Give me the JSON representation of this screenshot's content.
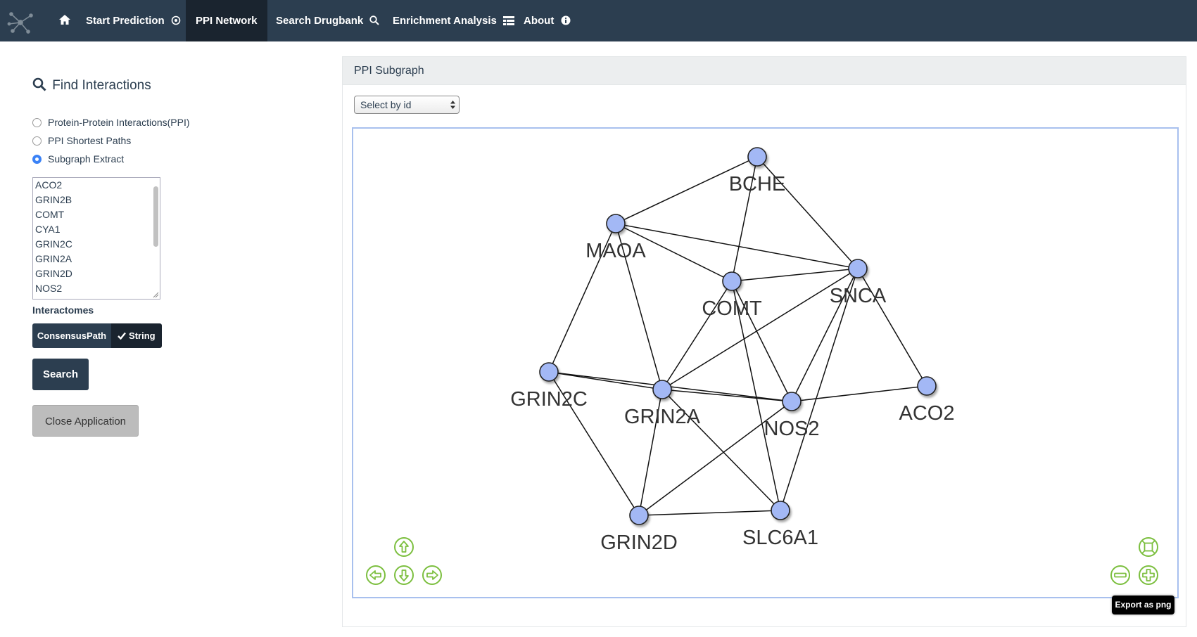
{
  "navbar": {
    "brand_icon": "network-logo-icon",
    "home_icon": "home-icon",
    "items": [
      {
        "label": "Start Prediction",
        "icon": "circle-dot-icon"
      },
      {
        "label": "PPI Network",
        "icon": "",
        "active": true
      },
      {
        "label": "Search Drugbank",
        "icon": "search-icon"
      },
      {
        "label": "Enrichment Analysis",
        "icon": "table-icon"
      },
      {
        "label": "About",
        "icon": "info-icon"
      }
    ]
  },
  "sidebar": {
    "title": "Find Interactions",
    "radios": [
      {
        "label": "Protein-Protein Interactions(PPI)",
        "checked": false
      },
      {
        "label": "PPI Shortest Paths",
        "checked": false
      },
      {
        "label": "Subgraph Extract",
        "checked": true
      }
    ],
    "genes": [
      "ACO2",
      "GRIN2B",
      "COMT",
      "CYA1",
      "GRIN2C",
      "GRIN2A",
      "GRIN2D",
      "NOS2"
    ],
    "interactomes_label": "Interactomes",
    "interactome_options": [
      {
        "label": "ConsensusPath",
        "selected": false
      },
      {
        "label": "String",
        "selected": true
      }
    ],
    "search_label": "Search",
    "close_label": "Close Application"
  },
  "panel": {
    "title": "PPI Subgraph",
    "select_value": "Select by id",
    "export_label": "Export as png",
    "accent_color": "#7cbf3f",
    "node_color": "#a3b8f5"
  },
  "network": {
    "nodes": [
      "BCHE",
      "MAOA",
      "COMT",
      "SNCA",
      "GRIN2C",
      "GRIN2A",
      "NOS2",
      "ACO2",
      "GRIN2D",
      "SLC6A1"
    ],
    "edges": [
      [
        "BCHE",
        "MAOA"
      ],
      [
        "BCHE",
        "COMT"
      ],
      [
        "BCHE",
        "SNCA"
      ],
      [
        "MAOA",
        "SNCA"
      ],
      [
        "MAOA",
        "COMT"
      ],
      [
        "MAOA",
        "GRIN2C"
      ],
      [
        "MAOA",
        "GRIN2A"
      ],
      [
        "COMT",
        "SNCA"
      ],
      [
        "COMT",
        "GRIN2A"
      ],
      [
        "COMT",
        "NOS2"
      ],
      [
        "COMT",
        "SLC6A1"
      ],
      [
        "SNCA",
        "GRIN2A"
      ],
      [
        "SNCA",
        "NOS2"
      ],
      [
        "SNCA",
        "SLC6A1"
      ],
      [
        "SNCA",
        "ACO2"
      ],
      [
        "GRIN2C",
        "GRIN2A"
      ],
      [
        "GRIN2C",
        "NOS2"
      ],
      [
        "GRIN2C",
        "GRIN2D"
      ],
      [
        "GRIN2A",
        "NOS2"
      ],
      [
        "GRIN2A",
        "GRIN2D"
      ],
      [
        "GRIN2A",
        "SLC6A1"
      ],
      [
        "NOS2",
        "ACO2"
      ],
      [
        "NOS2",
        "GRIN2D"
      ],
      [
        "GRIN2D",
        "SLC6A1"
      ]
    ]
  }
}
